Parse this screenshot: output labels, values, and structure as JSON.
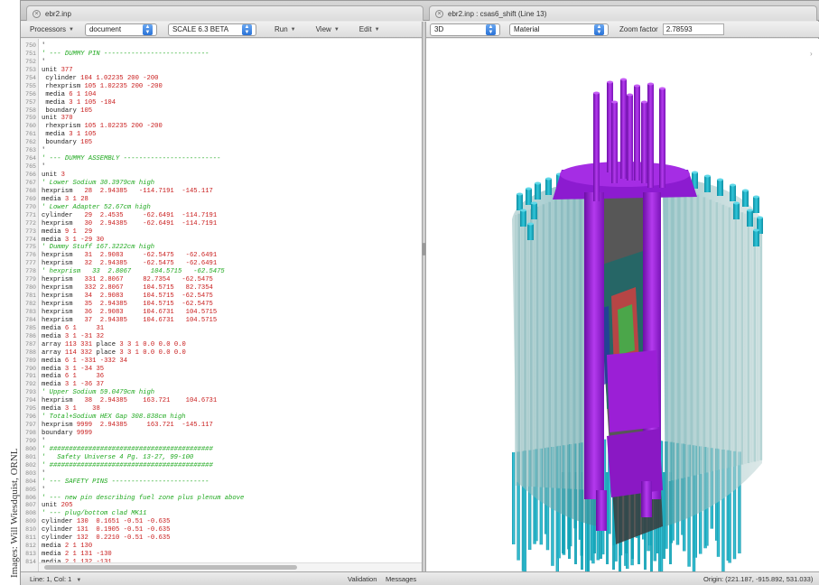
{
  "credit": "Images: Will Wiesdquist, ORNL",
  "tabs": {
    "left_title": "ebr2.inp",
    "right_title": "ebr2.inp : csas6_shift (Line 13)"
  },
  "toolbar_left": {
    "processors_label": "Processors",
    "document_select": "document",
    "scale_select": "SCALE 6.3 BETA",
    "run_label": "Run",
    "view_label": "View",
    "edit_label": "Edit"
  },
  "toolbar_right": {
    "view_mode_select": "3D",
    "color_by_select": "Material",
    "zoom_label": "Zoom factor",
    "zoom_value": "2.78593"
  },
  "status": {
    "cursor": "Line: 1, Col: 1",
    "validation": "Validation",
    "messages": "Messages",
    "origin": "Origin: (221.187, -915.892, 531.033)"
  },
  "colors": {
    "comment": "#1ea81e",
    "number": "#c81a1a",
    "cyan_pins": "#1fb3c8",
    "magenta": "#9b1fd6",
    "grey_shell": "#8fb8ba"
  },
  "code_lines": [
    {
      "n": "750",
      "t": "'"
    },
    {
      "n": "751",
      "t": "' --- DUMMY PIN ---------------------------",
      "c": true
    },
    {
      "n": "752",
      "t": "'"
    },
    {
      "n": "753",
      "t": "unit 377"
    },
    {
      "n": "754",
      "t": " cylinder 104 1.02235 200 -200"
    },
    {
      "n": "755",
      "t": " rhexprism 105 1.02235 200 -200"
    },
    {
      "n": "756",
      "t": " media 6 1 104"
    },
    {
      "n": "757",
      "t": " media 3 1 105 -104"
    },
    {
      "n": "758",
      "t": " boundary 105"
    },
    {
      "n": "759",
      "t": "unit 370"
    },
    {
      "n": "760",
      "t": " rhexprism 105 1.02235 200 -200"
    },
    {
      "n": "761",
      "t": " media 3 1 105"
    },
    {
      "n": "762",
      "t": " boundary 105"
    },
    {
      "n": "763",
      "t": "'"
    },
    {
      "n": "764",
      "t": "' --- DUMMY ASSEMBLY -------------------------",
      "c": true
    },
    {
      "n": "765",
      "t": "'"
    },
    {
      "n": "766",
      "t": "unit 3"
    },
    {
      "n": "767",
      "t": "' Lower Sodium 30.3979cm high",
      "c": true
    },
    {
      "n": "768",
      "t": "hexprism   28  2.94385   -114.7191  -145.117"
    },
    {
      "n": "769",
      "t": "media 3 1 28"
    },
    {
      "n": "770",
      "t": "' Lower Adapter 52.67cm high",
      "c": true
    },
    {
      "n": "771",
      "t": "cylinder   29  2.4535     -62.6491  -114.7191"
    },
    {
      "n": "772",
      "t": "hexprism   30  2.94385    -62.6491  -114.7191"
    },
    {
      "n": "773",
      "t": "media 9 1  29"
    },
    {
      "n": "774",
      "t": "media 3 1 -29 30"
    },
    {
      "n": "775",
      "t": "' Dummy Stuff 167.3222cm high",
      "c": true
    },
    {
      "n": "776",
      "t": "hexprism   31  2.9083     -62.5475   -62.6491"
    },
    {
      "n": "777",
      "t": "hexprism   32  2.94385    -62.5475   -62.6491"
    },
    {
      "n": "778",
      "t": "' hexprism   33  2.8067     104.5715   -62.5475",
      "c": true
    },
    {
      "n": "779",
      "t": "hexprism   331 2.8067     82.7354   -62.5475"
    },
    {
      "n": "780",
      "t": "hexprism   332 2.8067     104.5715   82.7354"
    },
    {
      "n": "781",
      "t": "hexprism   34  2.9083     104.5715  -62.5475"
    },
    {
      "n": "782",
      "t": "hexprism   35  2.94385    104.5715  -62.5475"
    },
    {
      "n": "783",
      "t": "hexprism   36  2.9083     104.6731   104.5715"
    },
    {
      "n": "784",
      "t": "hexprism   37  2.94385    104.6731   104.5715"
    },
    {
      "n": "785",
      "t": "media 6 1     31"
    },
    {
      "n": "786",
      "t": "media 3 1 -31 32"
    },
    {
      "n": "787",
      "t": "array 113 331 place 3 3 1 0.0 0.0 0.0"
    },
    {
      "n": "788",
      "t": "array 114 332 place 3 3 1 0.0 0.0 0.0"
    },
    {
      "n": "789",
      "t": "media 6 1 -331 -332 34"
    },
    {
      "n": "790",
      "t": "media 3 1 -34 35"
    },
    {
      "n": "791",
      "t": "media 6 1     36"
    },
    {
      "n": "792",
      "t": "media 3 1 -36 37"
    },
    {
      "n": "793",
      "t": "' Upper Sodium 59.0479cm high",
      "c": true
    },
    {
      "n": "794",
      "t": "hexprism   38  2.94385    163.721    104.6731"
    },
    {
      "n": "795",
      "t": "media 3 1    38"
    },
    {
      "n": "796",
      "t": "' Total+Sodium HEX Gap 308.838cm high",
      "c": true
    },
    {
      "n": "797",
      "t": "hexprism 9999  2.94385     163.721  -145.117"
    },
    {
      "n": "798",
      "t": "boundary 9999"
    },
    {
      "n": "799",
      "t": "'"
    },
    {
      "n": "800",
      "t": "' ##########################################",
      "c": true
    },
    {
      "n": "801",
      "t": "'   Safety Universe 4 Pg. 13-27, 99-100",
      "c": true
    },
    {
      "n": "802",
      "t": "' ##########################################",
      "c": true
    },
    {
      "n": "803",
      "t": "'"
    },
    {
      "n": "804",
      "t": "' --- SAFETY PINS -------------------------",
      "c": true
    },
    {
      "n": "805",
      "t": "'"
    },
    {
      "n": "806",
      "t": "' --- new pin describing fuel zone plus plenum above",
      "c": true
    },
    {
      "n": "807",
      "t": "unit 205"
    },
    {
      "n": "808",
      "t": "' --- plug/bottom clad MK11",
      "c": true
    },
    {
      "n": "809",
      "t": "cylinder 130  0.1651 -0.51 -0.635"
    },
    {
      "n": "810",
      "t": "cylinder 131  0.1905 -0.51 -0.635"
    },
    {
      "n": "811",
      "t": "cylinder 132  0.2210 -0.51 -0.635"
    },
    {
      "n": "812",
      "t": "media 2 1 130"
    },
    {
      "n": "813",
      "t": "media 2 1 131 -130"
    },
    {
      "n": "814",
      "t": "media 2 1 132 -131"
    }
  ]
}
